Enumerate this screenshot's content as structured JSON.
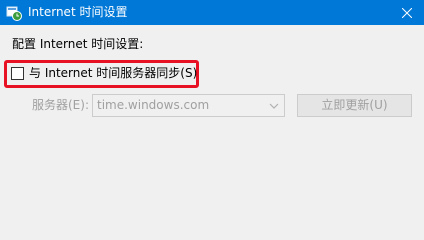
{
  "window": {
    "title": "Internet 时间设置"
  },
  "main": {
    "config_label": "配置 Internet 时间设置:",
    "sync_checkbox": {
      "label": "与 Internet 时间服务器同步(S)",
      "checked": false
    },
    "server": {
      "label": "服务器(E):",
      "value": "time.windows.com",
      "enabled": false
    },
    "update_button": {
      "label": "立即更新(U)",
      "enabled": false
    }
  },
  "icons": [
    "clock-globe-icon",
    "close-icon",
    "chevron-down-icon"
  ],
  "colors": {
    "titlebar": "#0078d7",
    "highlight": "#e81123",
    "disabled_text": "#a0a0a0"
  }
}
